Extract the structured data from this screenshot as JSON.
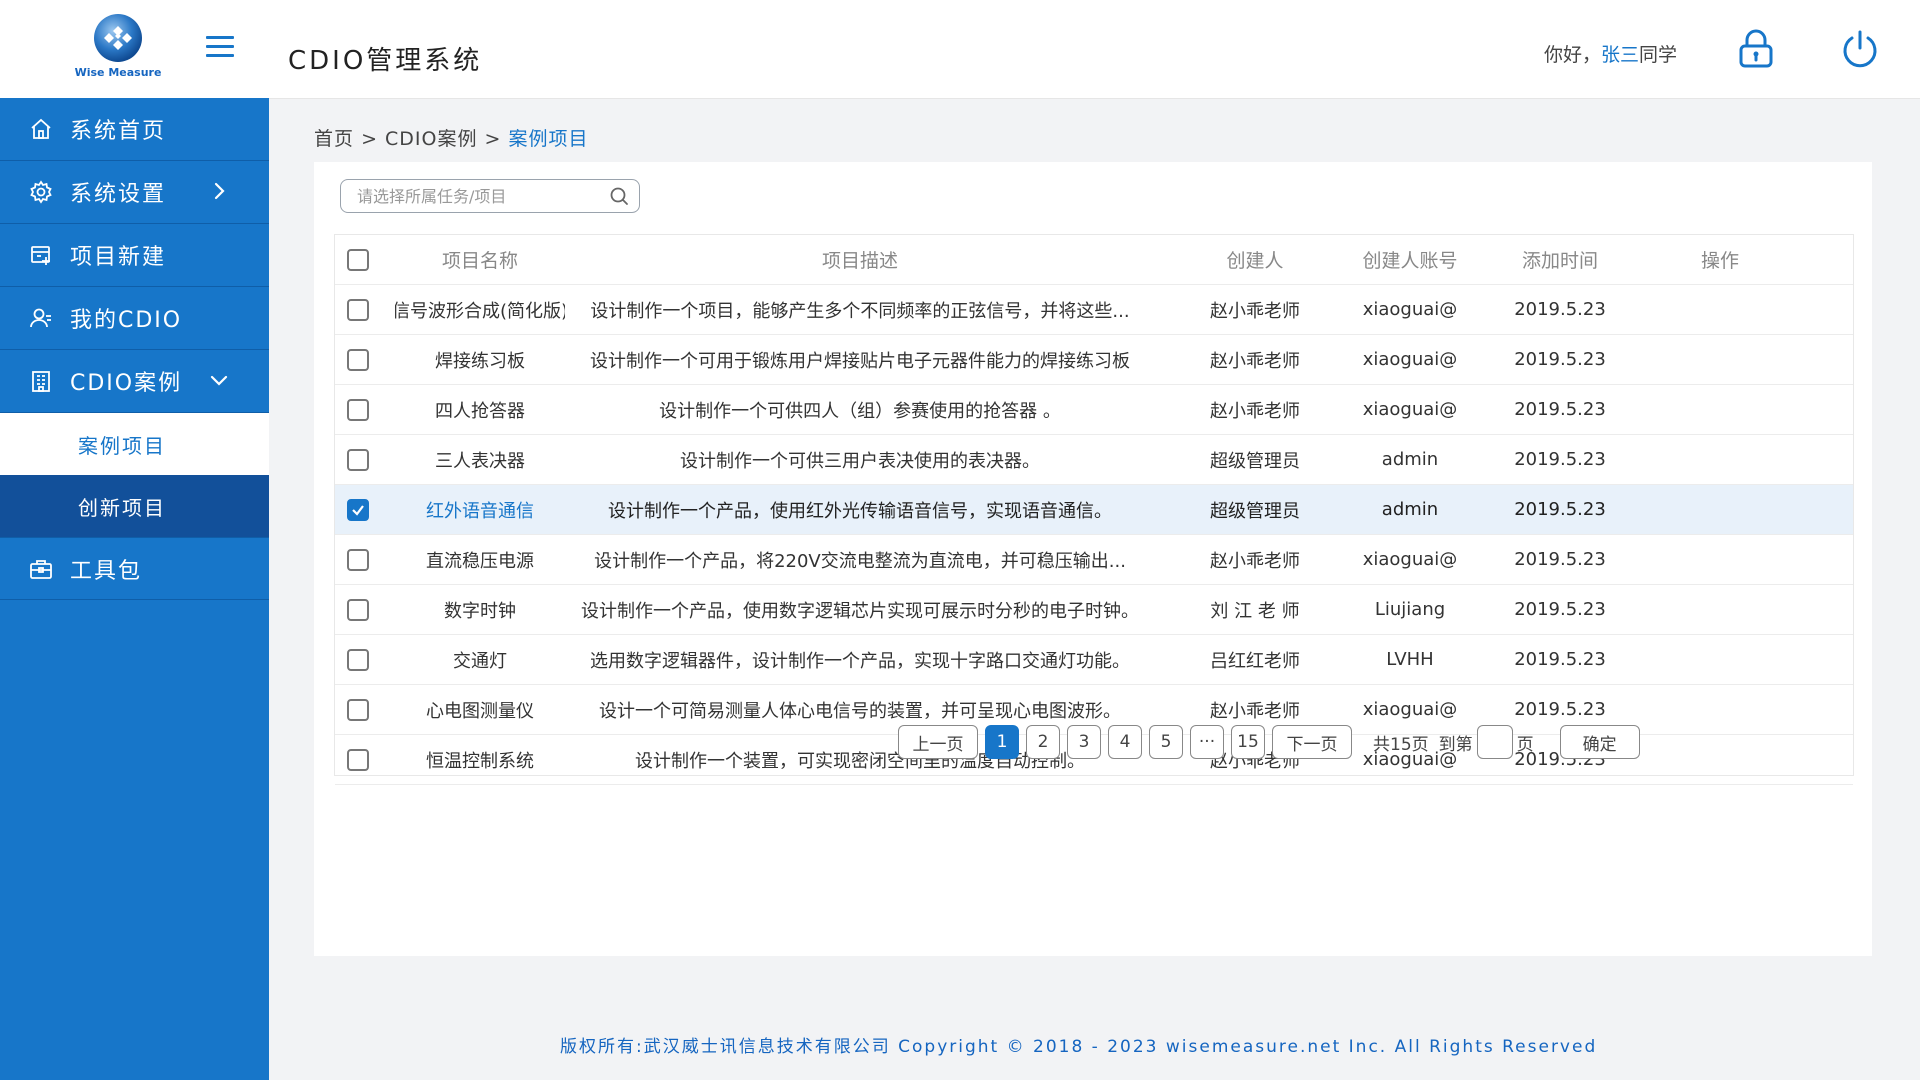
{
  "header": {
    "logo_text": "Wise Measure",
    "app_title": "CDIO管理系统",
    "greeting_prefix": "你好，",
    "user_name": "张三",
    "greeting_suffix": "同学"
  },
  "sidebar": {
    "items": [
      {
        "label": "系统首页",
        "icon": "home-icon"
      },
      {
        "label": "系统设置",
        "icon": "gear-icon"
      },
      {
        "label": "项目新建",
        "icon": "new-project-icon"
      },
      {
        "label": "我的CDIO",
        "icon": "user-icon"
      },
      {
        "label": "CDIO案例",
        "icon": "building-icon"
      },
      {
        "label": "工具包",
        "icon": "toolbox-icon"
      }
    ],
    "sub_items": [
      "案例项目",
      "创新项目"
    ]
  },
  "breadcrumb": {
    "home": "首页",
    "sep1": ">",
    "level2": "CDIO案例",
    "sep2": ">",
    "current": "案例项目"
  },
  "search": {
    "placeholder": "请选择所属任务/项目"
  },
  "table": {
    "headers": [
      "项目名称",
      "项目描述",
      "创建人",
      "创建人账号",
      "添加时间",
      "操作"
    ],
    "rows": [
      {
        "name": "信号波形合成(简化版)",
        "desc": "设计制作一个项目，能够产生多个不同频率的正弦信号，并将这些...",
        "creator": "赵小乖老师",
        "account": "xiaoguai@",
        "time": "2019.5.23",
        "checked": false
      },
      {
        "name": "焊接练习板",
        "desc": "设计制作一个可用于锻炼用户焊接贴片电子元器件能力的焊接练习板",
        "creator": "赵小乖老师",
        "account": "xiaoguai@",
        "time": "2019.5.23",
        "checked": false
      },
      {
        "name": "四人抢答器",
        "desc": "设计制作一个可供四人（组）参赛使用的抢答器 。",
        "creator": "赵小乖老师",
        "account": "xiaoguai@",
        "time": "2019.5.23",
        "checked": false
      },
      {
        "name": "三人表决器",
        "desc": "设计制作一个可供三用户表决使用的表决器。",
        "creator": "超级管理员",
        "account": "admin",
        "time": "2019.5.23",
        "checked": false
      },
      {
        "name": "红外语音通信",
        "desc": "设计制作一个产品，使用红外光传输语音信号，实现语音通信。",
        "creator": "超级管理员",
        "account": "admin",
        "time": "2019.5.23",
        "checked": true
      },
      {
        "name": "直流稳压电源",
        "desc": "设计制作一个产品，将220V交流电整流为直流电，并可稳压输出...",
        "creator": "赵小乖老师",
        "account": "xiaoguai@",
        "time": "2019.5.23",
        "checked": false
      },
      {
        "name": "数字时钟",
        "desc": "设计制作一个产品，使用数字逻辑芯片实现可展示时分秒的电子时钟。",
        "creator": "刘 江 老 师",
        "account": "Liujiang",
        "time": "2019.5.23",
        "checked": false
      },
      {
        "name": "交通灯",
        "desc": "选用数字逻辑器件，设计制作一个产品，实现十字路口交通灯功能。",
        "creator": "吕红红老师",
        "account": "LVHH",
        "time": "2019.5.23",
        "checked": false
      },
      {
        "name": "心电图测量仪",
        "desc": "设计一个可简易测量人体心电信号的装置，并可呈现心电图波形。",
        "creator": "赵小乖老师",
        "account": "xiaoguai@",
        "time": "2019.5.23",
        "checked": false
      },
      {
        "name": "恒温控制系统",
        "desc": "设计制作一个装置，可实现密闭空间里的温度自动控制。",
        "creator": "赵小乖老师",
        "account": "xiaoguai@",
        "time": "2019.5.23",
        "checked": false
      }
    ]
  },
  "pager": {
    "prev": "上一页",
    "pages": [
      "1",
      "2",
      "3",
      "4",
      "5",
      "···",
      "15"
    ],
    "active_page": "1",
    "next": "下一页",
    "total": "共15页",
    "goto_prefix": "到第",
    "goto_suffix": "页",
    "confirm": "确定"
  },
  "footer": {
    "text": "版权所有:武汉威士讯信息技术有限公司 Copyright © 2018 - 2023 wisemeasure.net Inc. All Rights Reserved"
  },
  "colors": {
    "primary": "#1776c9",
    "sidebar_dark": "#12509a",
    "selected_row": "#e8f1fa"
  }
}
